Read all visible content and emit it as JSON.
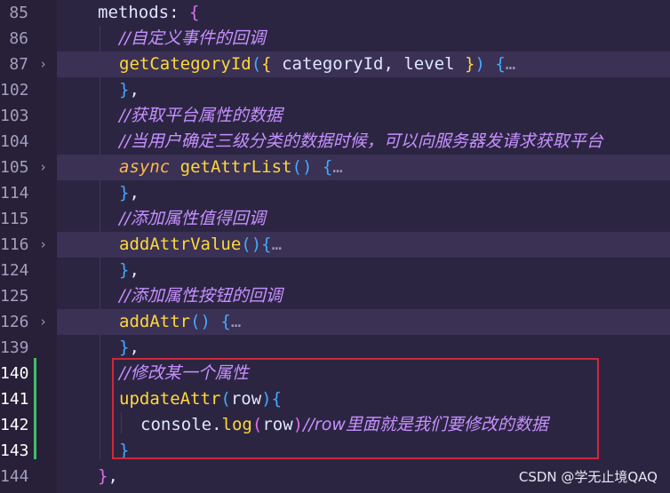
{
  "editor": {
    "lines": [
      {
        "num": "85",
        "folded": false,
        "tokens": [
          {
            "t": "methods",
            "c": "ident"
          },
          {
            "t": ": ",
            "c": "punc"
          },
          {
            "t": "{",
            "c": "brace1"
          }
        ],
        "indent": 110
      },
      {
        "num": "86",
        "folded": false,
        "tokens": [
          {
            "t": "//自定义事件的回调",
            "c": "cmt"
          }
        ],
        "indent": 134
      },
      {
        "num": "87",
        "folded": true,
        "tokens": [
          {
            "t": "getCategoryId",
            "c": "fn"
          },
          {
            "t": "(",
            "c": "brace2"
          },
          {
            "t": "{ ",
            "c": "kw"
          },
          {
            "t": "categoryId",
            "c": "param"
          },
          {
            "t": ", ",
            "c": "punc"
          },
          {
            "t": "level",
            "c": "param"
          },
          {
            "t": " }",
            "c": "kw"
          },
          {
            "t": ")",
            "c": "brace2"
          },
          {
            "t": " {",
            "c": "brace2"
          },
          {
            "t": "…",
            "c": "ellipsis"
          }
        ],
        "indent": 134
      },
      {
        "num": "102",
        "folded": false,
        "tokens": [
          {
            "t": "}",
            "c": "brace2"
          },
          {
            "t": ",",
            "c": "punc"
          }
        ],
        "indent": 134
      },
      {
        "num": "103",
        "folded": false,
        "tokens": [
          {
            "t": "//获取平台属性的数据",
            "c": "cmt"
          }
        ],
        "indent": 134
      },
      {
        "num": "104",
        "folded": false,
        "tokens": [
          {
            "t": "//当用户确定三级分类的数据时候，可以向服务器发请求获取平台",
            "c": "cmt"
          }
        ],
        "indent": 134
      },
      {
        "num": "105",
        "folded": true,
        "tokens": [
          {
            "t": "async",
            "c": "async"
          },
          {
            "t": " ",
            "c": "punc"
          },
          {
            "t": "getAttrList",
            "c": "fn"
          },
          {
            "t": "()",
            "c": "brace2"
          },
          {
            "t": " {",
            "c": "brace2"
          },
          {
            "t": "…",
            "c": "ellipsis"
          }
        ],
        "indent": 134
      },
      {
        "num": "114",
        "folded": false,
        "tokens": [
          {
            "t": "}",
            "c": "brace2"
          },
          {
            "t": ",",
            "c": "punc"
          }
        ],
        "indent": 134
      },
      {
        "num": "115",
        "folded": false,
        "tokens": [
          {
            "t": "//添加属性值得回调",
            "c": "cmt"
          }
        ],
        "indent": 134
      },
      {
        "num": "116",
        "folded": true,
        "tokens": [
          {
            "t": "addAttrValue",
            "c": "fn"
          },
          {
            "t": "(){",
            "c": "brace2"
          },
          {
            "t": "…",
            "c": "ellipsis"
          }
        ],
        "indent": 134
      },
      {
        "num": "124",
        "folded": false,
        "tokens": [
          {
            "t": "}",
            "c": "brace2"
          },
          {
            "t": ",",
            "c": "punc"
          }
        ],
        "indent": 134
      },
      {
        "num": "125",
        "folded": false,
        "tokens": [
          {
            "t": "//添加属性按钮的回调",
            "c": "cmt"
          }
        ],
        "indent": 134
      },
      {
        "num": "126",
        "folded": true,
        "tokens": [
          {
            "t": "addAttr",
            "c": "fn"
          },
          {
            "t": "()",
            "c": "brace2"
          },
          {
            "t": " {",
            "c": "brace2"
          },
          {
            "t": "…",
            "c": "ellipsis"
          }
        ],
        "indent": 134
      },
      {
        "num": "139",
        "folded": false,
        "tokens": [
          {
            "t": "}",
            "c": "brace2"
          },
          {
            "t": ",",
            "c": "punc"
          }
        ],
        "indent": 134
      },
      {
        "num": "140",
        "folded": false,
        "active": true,
        "tokens": [
          {
            "t": "//修改某一个属性",
            "c": "cmt"
          }
        ],
        "indent": 134
      },
      {
        "num": "141",
        "folded": false,
        "active": true,
        "tokens": [
          {
            "t": "updateAttr",
            "c": "fn"
          },
          {
            "t": "(",
            "c": "brace2"
          },
          {
            "t": "row",
            "c": "param"
          },
          {
            "t": ")",
            "c": "brace2"
          },
          {
            "t": "{",
            "c": "brace2"
          }
        ],
        "indent": 134
      },
      {
        "num": "142",
        "folded": false,
        "active": true,
        "tokens": [
          {
            "t": "console",
            "c": "param"
          },
          {
            "t": ".",
            "c": "punc"
          },
          {
            "t": "log",
            "c": "fn"
          },
          {
            "t": "(",
            "c": "brace1"
          },
          {
            "t": "row",
            "c": "param"
          },
          {
            "t": ")",
            "c": "brace1"
          },
          {
            "t": "//row里面就是我们要修改的数据",
            "c": "cmt"
          }
        ],
        "indent": 158
      },
      {
        "num": "143",
        "folded": false,
        "active": true,
        "tokens": [
          {
            "t": "}",
            "c": "brace2"
          }
        ],
        "indent": 134
      },
      {
        "num": "144",
        "folded": false,
        "tokens": [
          {
            "t": "}",
            "c": "brace1"
          },
          {
            "t": ",",
            "c": "punc"
          }
        ],
        "indent": 110
      }
    ]
  },
  "watermark": "CSDN @学无止境QAQ",
  "colors": {
    "background": "#2c2542",
    "keyword": "#ffd83a",
    "comment": "#c690ff",
    "highlight_box": "#d0283a",
    "modified_bar": "#3fbf6a"
  }
}
